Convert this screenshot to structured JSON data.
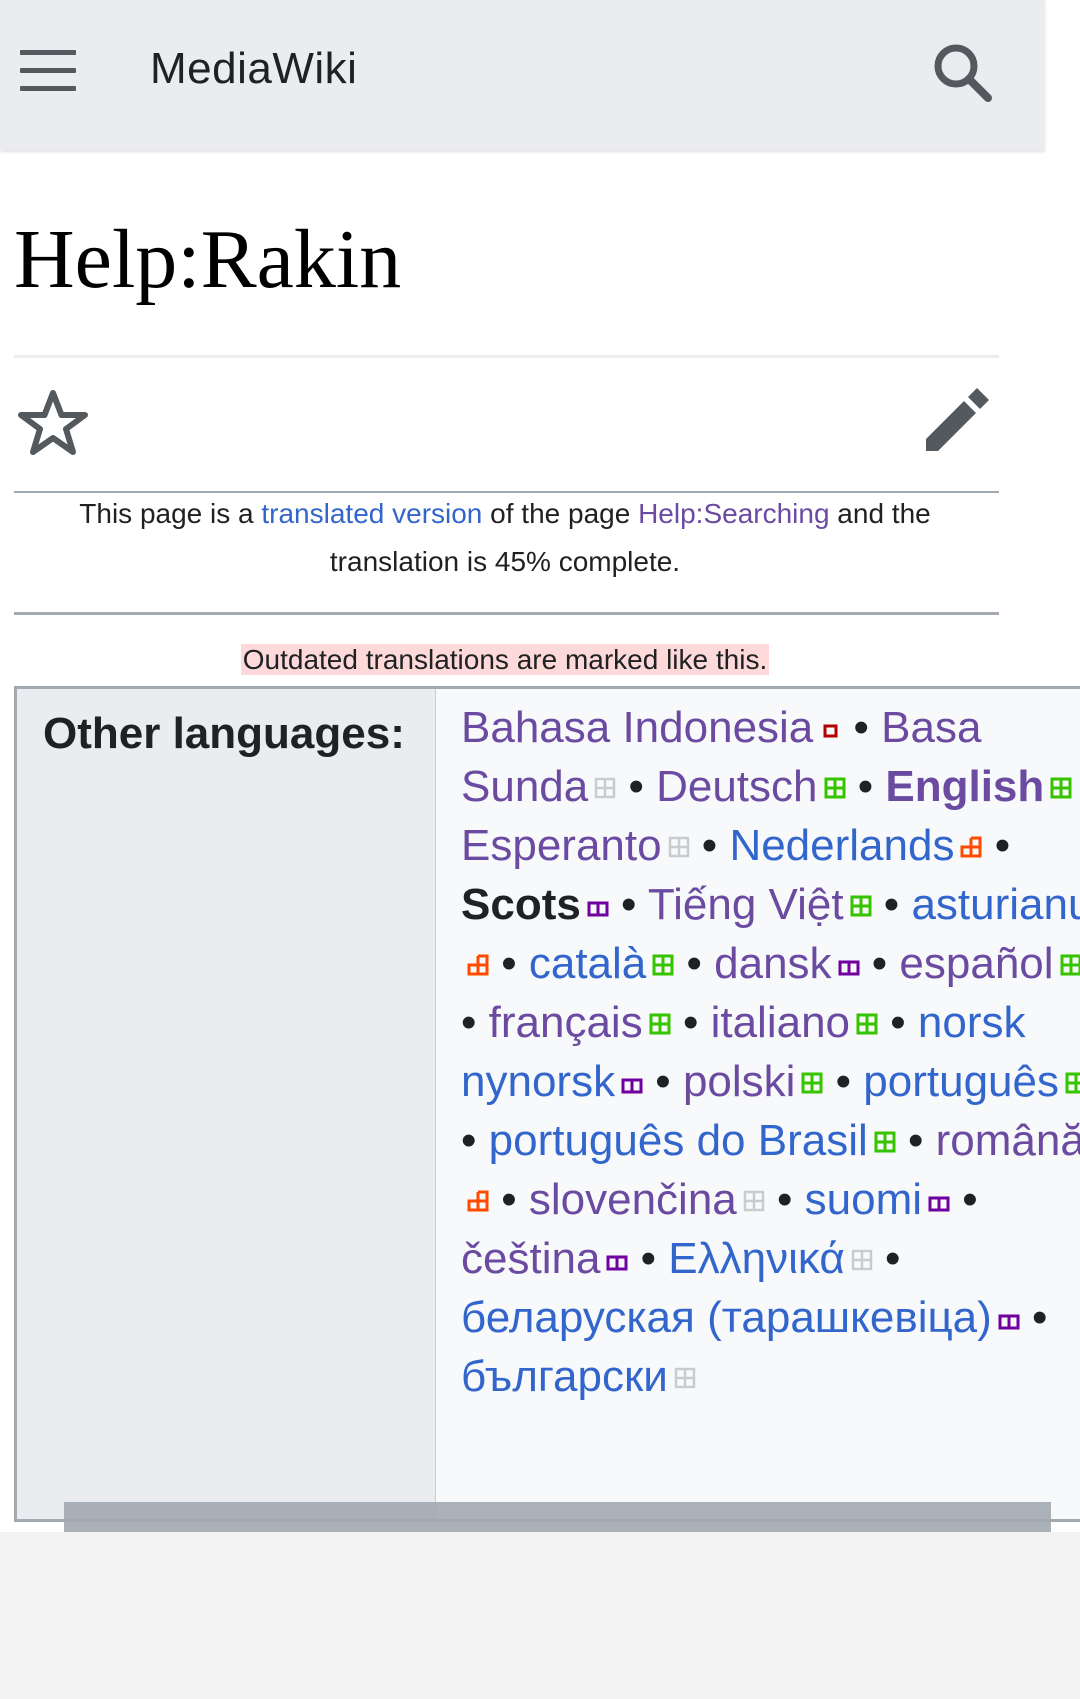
{
  "header": {
    "brand": "MediaWiki",
    "menu_icon": "hamburger-menu-icon",
    "search_icon": "search-icon"
  },
  "page": {
    "title": "Help:Rakin",
    "watch_icon": "star-icon",
    "edit_icon": "pencil-icon"
  },
  "translate_notice": {
    "prefix": "This page is a ",
    "link1": "translated version",
    "middle": " of the page ",
    "link2": "Help:Searching",
    "suffix": " and the translation is 45% complete."
  },
  "outdated_note": "Outdated translations are marked like this.",
  "other_languages": {
    "label": "Other languages:",
    "separator": " • ",
    "items": [
      {
        "name": "Bahasa Indonesia",
        "status": "outdated"
      },
      {
        "name": "Basa Sunda",
        "status": "none"
      },
      {
        "name": "Deutsch",
        "status": "complete"
      },
      {
        "name": "English",
        "status": "complete"
      },
      {
        "name": "Esperanto",
        "status": "none"
      },
      {
        "name": "Nederlands",
        "status": "partial-high"
      },
      {
        "name": "Scots",
        "status": "partial-low"
      },
      {
        "name": "Tiếng Việt",
        "status": "complete"
      },
      {
        "name": "asturianu",
        "status": "partial-high"
      },
      {
        "name": "català",
        "status": "complete"
      },
      {
        "name": "dansk",
        "status": "partial-low"
      },
      {
        "name": "español",
        "status": "complete"
      },
      {
        "name": "français",
        "status": "complete"
      },
      {
        "name": "italiano",
        "status": "complete"
      },
      {
        "name": "norsk nynorsk",
        "status": "partial-low"
      },
      {
        "name": "polski",
        "status": "complete"
      },
      {
        "name": "português",
        "status": "complete"
      },
      {
        "name": "português do Brasil",
        "status": "complete"
      },
      {
        "name": "română",
        "status": "partial-high"
      },
      {
        "name": "slovenčina",
        "status": "none"
      },
      {
        "name": "suomi",
        "status": "partial-low"
      },
      {
        "name": "čeština",
        "status": "partial-low"
      },
      {
        "name": "Ελληνικά",
        "status": "none"
      },
      {
        "name": "беларуская (тарашкевіца)",
        "status": "partial-low"
      },
      {
        "name": "български",
        "status": "none"
      }
    ]
  },
  "colors": {
    "link": "#3366cc",
    "visited": "#6b4ba1",
    "complete": "#36c300",
    "partial_high": "#ff4a00",
    "partial_low": "#7000a0",
    "outdated": "#b30000",
    "none": "#c8ccd1"
  }
}
